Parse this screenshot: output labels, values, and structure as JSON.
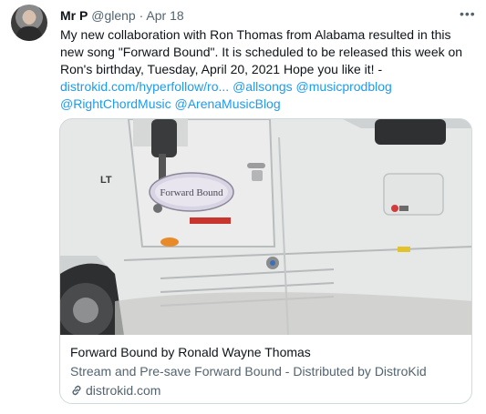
{
  "tweet": {
    "author_name": "Mr P",
    "handle": "@glenp",
    "separator": "·",
    "date": "Apr 18",
    "text_line1": "My new collaboration with Ron Thomas from Alabama resulted in this",
    "text_line2": "new song \"Forward Bound\". It is scheduled to be released this week on",
    "text_line3_plain": "Ron's birthday, Tuesday, April 20, 2021 Hope you like it! -",
    "link_url": "distrokid.com/hyperfollow/ro...",
    "mention_allsongs": "@allsongs",
    "mention_musicprodblog": "@musicprodblog",
    "mention_rightchord": "@RightChordMusic",
    "mention_arena": "@ArenaMusicBlog"
  },
  "card": {
    "title": "Forward Bound by Ronald Wayne Thomas",
    "description": "Stream and Pre-save Forward Bound - Distributed by DistroKid",
    "domain": "distrokid.com",
    "image_label": "Forward Bound",
    "truck_brand": "LT"
  },
  "icons": {
    "more": "more-horizontal-icon",
    "link": "link-icon"
  }
}
